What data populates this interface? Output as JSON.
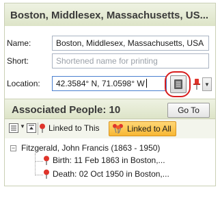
{
  "header": {
    "title": "Boston, Middlesex, Massachusetts, US..."
  },
  "form": {
    "name_label": "Name:",
    "name_value": "Boston, Middlesex, Massachusetts, USA",
    "short_label": "Short:",
    "short_placeholder": "Shortened name for printing",
    "location_label": "Location:",
    "location_value": "42.3584° N, 71.0598° W"
  },
  "associated": {
    "title": "Associated People: 10",
    "goto_label": "Go To"
  },
  "toolbar": {
    "linked_this_label": "Linked to This",
    "linked_all_label": "Linked to All"
  },
  "tree": {
    "person": "Fitzgerald, John Francis (1863 - 1950)",
    "events": [
      {
        "text": "Birth: 11 Feb 1863 in Boston,..."
      },
      {
        "text": "Death: 02 Oct 1950 in Boston,..."
      }
    ]
  },
  "colors": {
    "header_bg": "#dde4c8",
    "highlight_ring": "#d81e1e",
    "linked_all_bg": "#f7b733",
    "pin_red": "#e0342b"
  },
  "icons": [
    "book-icon",
    "pushpin-icon",
    "dropdown-arrow-icon",
    "expand-all-icon",
    "collapse-all-icon",
    "map-pin-icon",
    "multi-pin-icon",
    "tree-collapse-icon"
  ]
}
